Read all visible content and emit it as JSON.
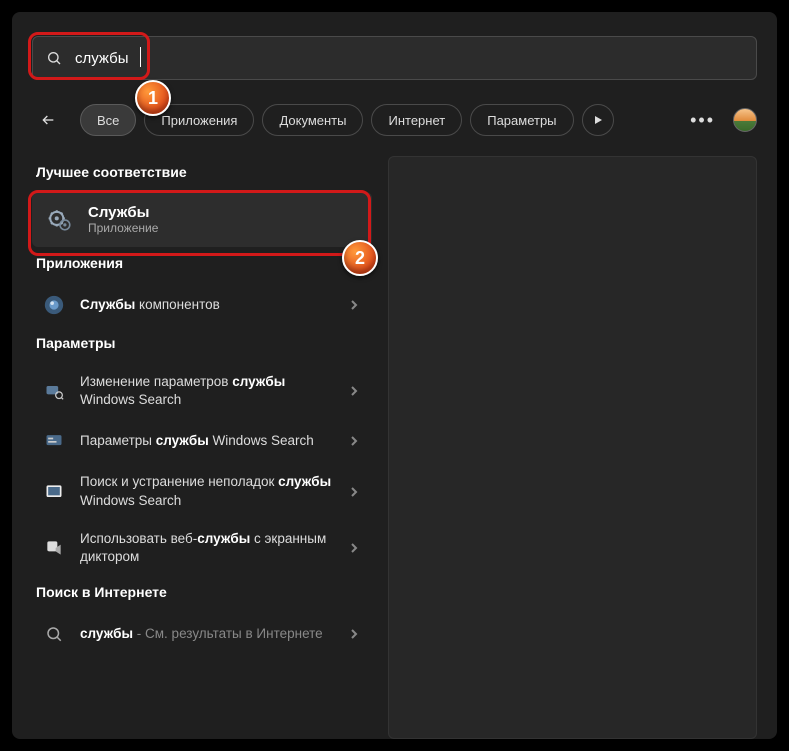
{
  "search": {
    "value": "службы"
  },
  "filters": {
    "back": "←",
    "chips": [
      "Все",
      "Приложения",
      "Документы",
      "Интернет",
      "Параметры"
    ]
  },
  "sections": {
    "best": "Лучшее соответствие",
    "apps": "Приложения",
    "settings": "Параметры",
    "web": "Поиск в Интернете"
  },
  "best_match": {
    "title": "Службы",
    "subtitle": "Приложение"
  },
  "apps": [
    {
      "prefix": "Службы",
      "suffix": " компонентов"
    }
  ],
  "settings": [
    {
      "html": "Изменение параметров <b>службы</b> Windows Search"
    },
    {
      "html": "Параметры <b>службы</b> Windows Search"
    },
    {
      "html": "Поиск и устранение неполадок <b>службы</b> Windows Search"
    },
    {
      "html": "Использовать веб-<b>службы</b> с экранным диктором"
    }
  ],
  "web": [
    {
      "bold": "службы",
      "rest": " - См. результаты в Интернете"
    }
  ],
  "annotations": {
    "one": "1",
    "two": "2"
  }
}
